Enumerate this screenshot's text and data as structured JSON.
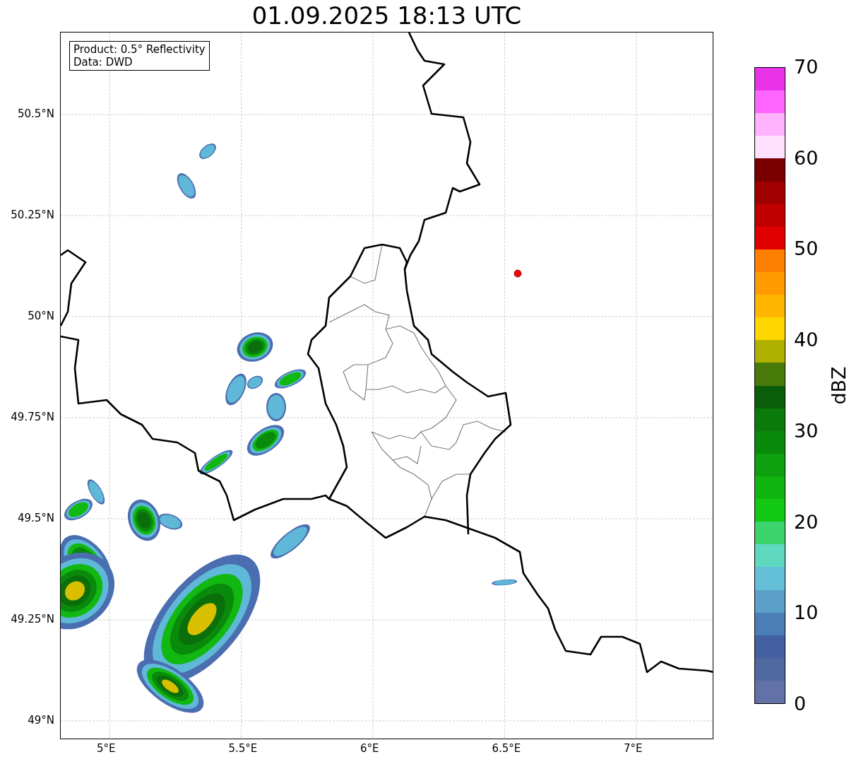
{
  "title": "01.09.2025 18:13 UTC",
  "legend": {
    "lines": [
      "Product: 0.5° Reflectivity",
      "Data: DWD"
    ]
  },
  "map": {
    "lat_ticks": [
      "50.5°N",
      "50.25°N",
      "50°N",
      "49.75°N",
      "49.5°N",
      "49.25°N",
      "49°N"
    ],
    "lon_ticks": [
      "5°E",
      "5.5°E",
      "6°E",
      "6.5°E",
      "7°E"
    ]
  },
  "colorbar": {
    "label": "dBZ",
    "ticks": [
      "70",
      "60",
      "50",
      "40",
      "30",
      "20",
      "10",
      "0"
    ],
    "bins": [
      {
        "color": "#e833e8"
      },
      {
        "color": "#ff66ff"
      },
      {
        "color": "#ffb3ff"
      },
      {
        "color": "#ffe0ff"
      },
      {
        "color": "#7a0000"
      },
      {
        "color": "#a00000"
      },
      {
        "color": "#c00000"
      },
      {
        "color": "#e00000"
      },
      {
        "color": "#ff7f00"
      },
      {
        "color": "#ff9a00"
      },
      {
        "color": "#ffb600"
      },
      {
        "color": "#ffd700"
      },
      {
        "color": "#b0b000"
      },
      {
        "color": "#487a0a"
      },
      {
        "color": "#0a5e0a"
      },
      {
        "color": "#0a7a0a"
      },
      {
        "color": "#0a8a0a"
      },
      {
        "color": "#0ea00e"
      },
      {
        "color": "#10b510"
      },
      {
        "color": "#12c812"
      },
      {
        "color": "#3cd46c"
      },
      {
        "color": "#5fd8c0"
      },
      {
        "color": "#64c0d8"
      },
      {
        "color": "#5aa0c8"
      },
      {
        "color": "#4a7eb4"
      },
      {
        "color": "#4460a0"
      },
      {
        "color": "#5068a0"
      },
      {
        "color": "#6272a8"
      }
    ]
  }
}
